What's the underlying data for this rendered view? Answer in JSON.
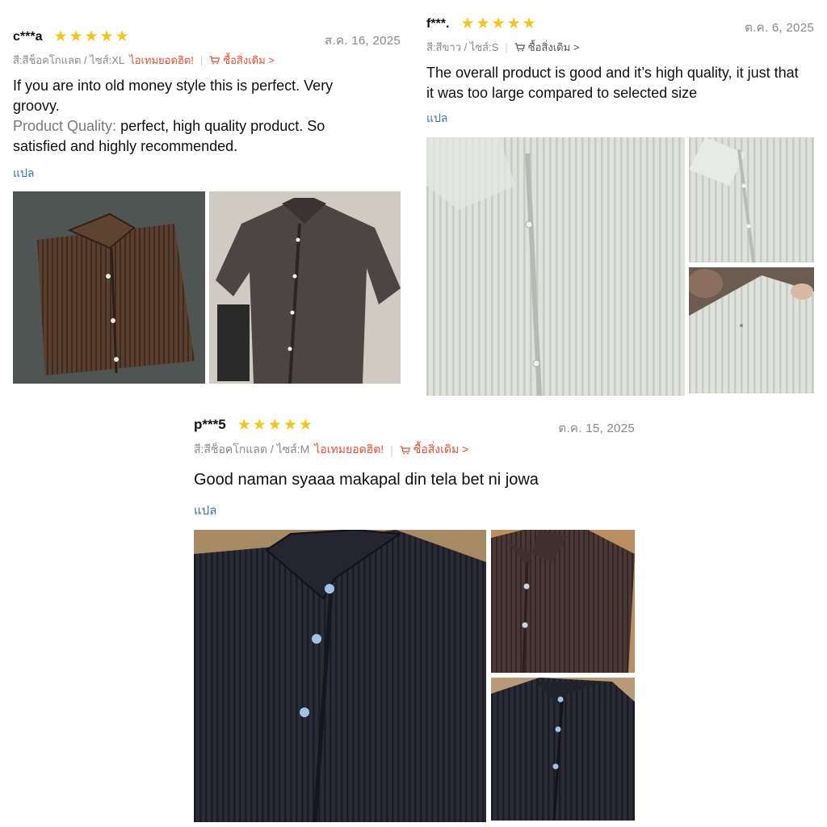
{
  "reviews": [
    {
      "user": "c***a",
      "rating": 5,
      "date": "ส.ค. 16, 2025",
      "variant": "สี:สีช็อคโกแลต / ไซส์:XL",
      "hot_label": "ไอเทมยอดฮิต!",
      "rebuy_label": "ซื้อสิ่งเดิม >",
      "text": "If you are into old money style this is perfect. Very groovy.",
      "quality_label": "Product Quality:",
      "quality_text": "perfect, high quality product. So satisfied and highly recommended.",
      "translate_label": "แปล"
    },
    {
      "user": "f***.",
      "rating": 5,
      "date": "ต.ค. 6, 2025",
      "variant": "สี:สีขาว / ไซส์:S",
      "rebuy_label": "ซื้อสิ่งเดิม >",
      "text": "The overall product is good and it’s high quality, it just that it was too large compared to selected size",
      "translate_label": "แปล"
    },
    {
      "user": "p***5",
      "rating": 5,
      "date": "ต.ค. 15, 2025",
      "variant": "สี:สีช็อคโกแลต / ไซส์:M",
      "hot_label": "ไอเทมยอดฮิต!",
      "rebuy_label": "ซื้อสิ่งเดิม >",
      "text": "Good naman syaaa makapal din tela bet ni jowa",
      "translate_label": "แปล"
    }
  ],
  "colors": {
    "star": "#f5c518",
    "accent": "#ee4d2d",
    "link": "#3b6fb5",
    "muted": "#888888"
  },
  "icons": [
    "star-icon",
    "cart-icon"
  ]
}
